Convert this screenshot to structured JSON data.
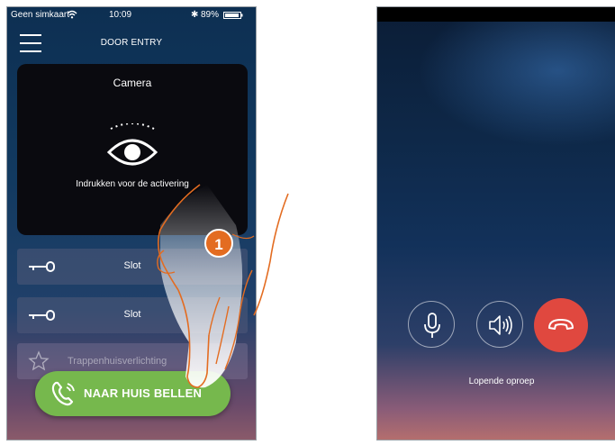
{
  "left_screen": {
    "status_bar": {
      "carrier": "Geen simkaart",
      "time": "10:09",
      "battery": "89%"
    },
    "header": {
      "title": "DOOR ENTRY",
      "menu_icon": "hamburger-menu-icon"
    },
    "camera": {
      "title": "Camera",
      "hint": "Indrukken voor de activering",
      "icon": "eye-icon"
    },
    "locks": [
      {
        "label": "Slot",
        "icon": "key-icon"
      },
      {
        "label": "Slot",
        "icon": "key-icon"
      }
    ],
    "stair_light": {
      "label": "Trappenhuisverlichting",
      "icon": "star-icon"
    },
    "call_button": {
      "label": "NAAR HUIS BELLEN",
      "icon": "phone-icon",
      "color": "#76b84d"
    },
    "step_marker": "1"
  },
  "right_screen": {
    "controls": [
      {
        "name": "mic",
        "icon": "microphone-icon"
      },
      {
        "name": "speaker",
        "icon": "speaker-icon"
      },
      {
        "name": "hangup",
        "icon": "hang-up-icon",
        "color": "#e0483f"
      }
    ],
    "call_status": "Lopende oproep"
  }
}
